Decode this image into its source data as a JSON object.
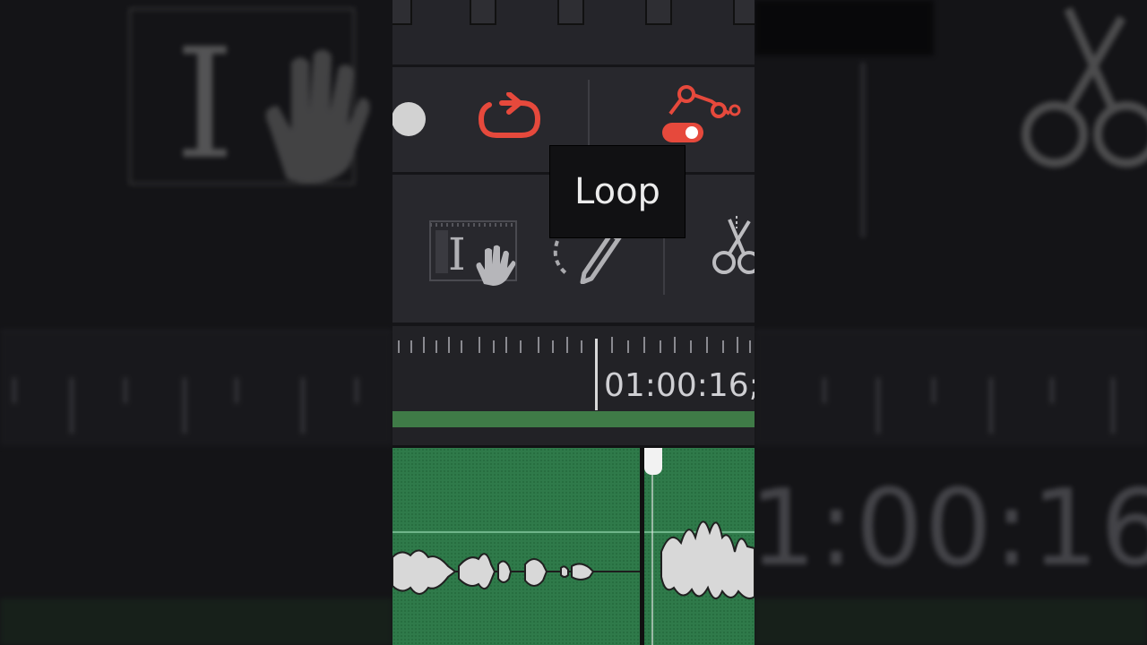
{
  "tooltip": {
    "text": "Loop"
  },
  "timeline": {
    "timecode": "01:00:16;"
  },
  "side_panel": {
    "timecode": "1:00:16;"
  },
  "icons": {
    "record": "record-dot-icon",
    "loop": "loop-icon",
    "keyframe_toggle": "keyframe-toggle-icon",
    "trim_hand": "trim-hand-icon",
    "pencil": "pencil-draw-icon",
    "blade": "scissors-icon"
  },
  "colors": {
    "accent_red": "#e6493c",
    "audio_green": "#2f7a4a",
    "timeline_bar": "#3f7b47",
    "panel_bg": "#28282d"
  }
}
